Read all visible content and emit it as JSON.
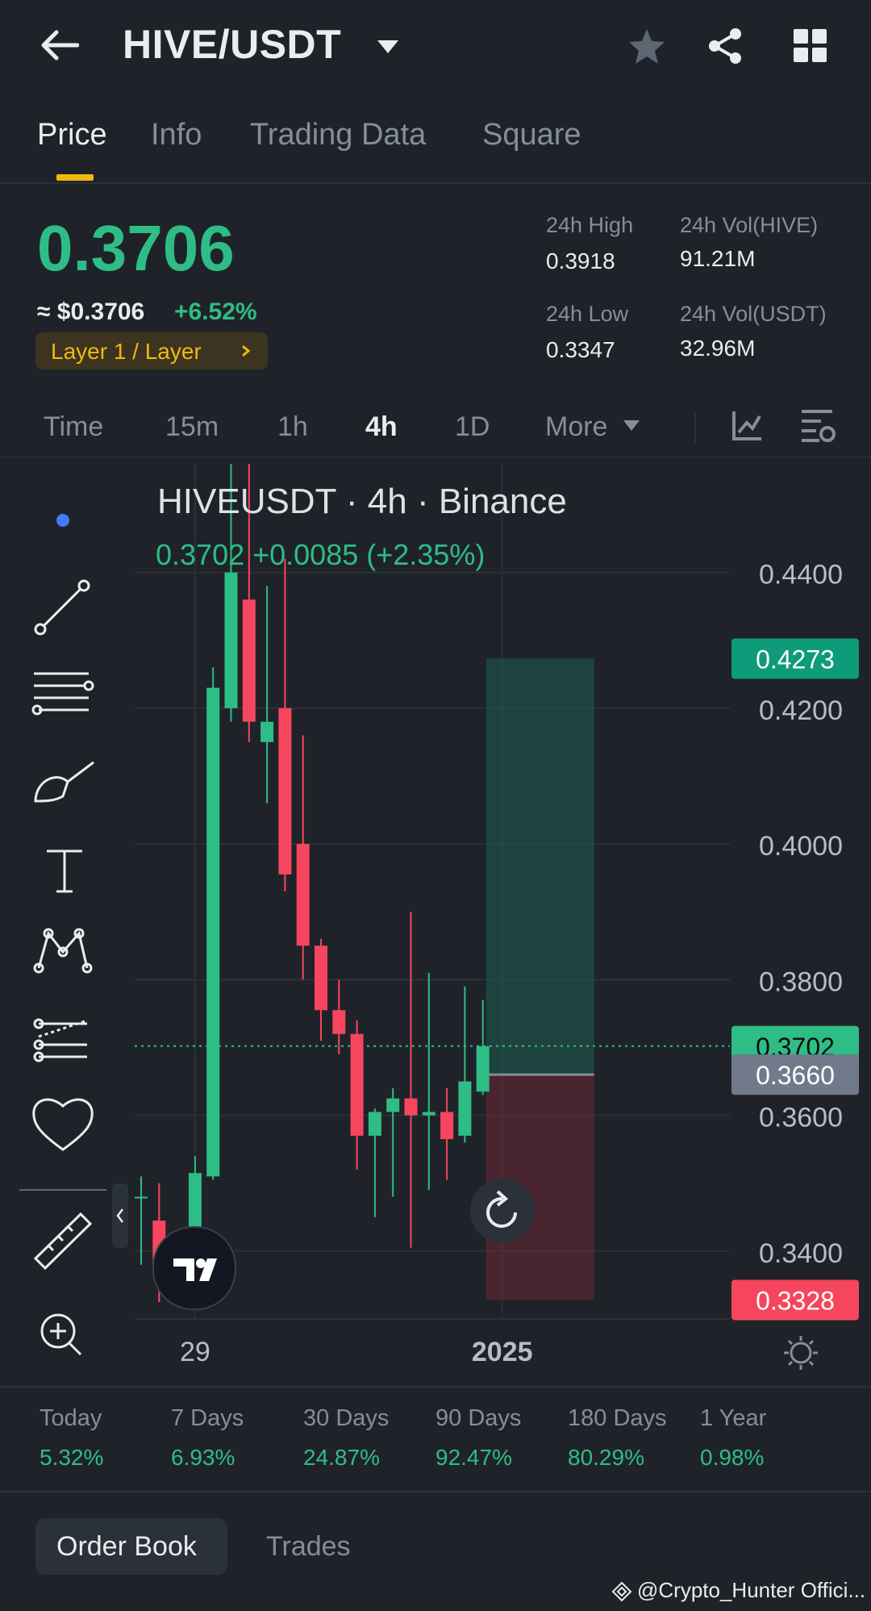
{
  "header": {
    "pair": "HIVE/USDT"
  },
  "tabs": [
    "Price",
    "Info",
    "Trading Data",
    "Square"
  ],
  "ticker": {
    "price": "0.3706",
    "approx": "≈ $0.3706",
    "change": "+6.52%",
    "tag": "Layer 1 / Layer",
    "high_label": "24h High",
    "high": "0.3918",
    "low_label": "24h Low",
    "low": "0.3347",
    "vol_base_label": "24h Vol(HIVE)",
    "vol_base": "91.21M",
    "vol_quote_label": "24h Vol(USDT)",
    "vol_quote": "32.96M"
  },
  "intervals": [
    "Time",
    "15m",
    "1h",
    "4h",
    "1D",
    "More"
  ],
  "active_interval": "4h",
  "chart_data": {
    "type": "candlestick",
    "title": "HIVEUSDT · 4h · Binance",
    "last_readout": "0.3702  +0.0085 (+2.35%)",
    "y_ticks": [
      "0.4400",
      "0.4200",
      "0.4000",
      "0.3800",
      "0.3600",
      "0.3400"
    ],
    "ylim": [
      0.33,
      0.456
    ],
    "x_labels": [
      "29",
      "2025"
    ],
    "price_tags": [
      {
        "value": "0.4273",
        "color": "#0d9b79"
      },
      {
        "value": "0.3702",
        "color": "#2ebd85"
      },
      {
        "value": "0.3660",
        "color": "#707a8a"
      },
      {
        "value": "0.3328",
        "color": "#f6465d"
      }
    ],
    "position": {
      "take_profit": 0.4273,
      "entry": 0.366,
      "stop_loss": 0.3328,
      "current": 0.3702
    },
    "candles": [
      {
        "o": 0.348,
        "h": 0.351,
        "l": 0.338,
        "c": 0.348
      },
      {
        "o": 0.3445,
        "h": 0.35,
        "l": 0.3325,
        "c": 0.338
      },
      {
        "o": 0.3395,
        "h": 0.342,
        "l": 0.333,
        "c": 0.3395
      },
      {
        "o": 0.335,
        "h": 0.354,
        "l": 0.333,
        "c": 0.3515
      },
      {
        "o": 0.351,
        "h": 0.426,
        "l": 0.3505,
        "c": 0.423
      },
      {
        "o": 0.42,
        "h": 0.46,
        "l": 0.418,
        "c": 0.44
      },
      {
        "o": 0.436,
        "h": 0.465,
        "l": 0.415,
        "c": 0.418
      },
      {
        "o": 0.415,
        "h": 0.438,
        "l": 0.406,
        "c": 0.418
      },
      {
        "o": 0.42,
        "h": 0.442,
        "l": 0.393,
        "c": 0.3955
      },
      {
        "o": 0.4,
        "h": 0.416,
        "l": 0.38,
        "c": 0.385
      },
      {
        "o": 0.385,
        "h": 0.386,
        "l": 0.371,
        "c": 0.3755
      },
      {
        "o": 0.3755,
        "h": 0.38,
        "l": 0.369,
        "c": 0.372
      },
      {
        "o": 0.372,
        "h": 0.374,
        "l": 0.352,
        "c": 0.357
      },
      {
        "o": 0.357,
        "h": 0.361,
        "l": 0.345,
        "c": 0.3605
      },
      {
        "o": 0.3605,
        "h": 0.364,
        "l": 0.348,
        "c": 0.3625
      },
      {
        "o": 0.3625,
        "h": 0.39,
        "l": 0.3405,
        "c": 0.36
      },
      {
        "o": 0.36,
        "h": 0.381,
        "l": 0.349,
        "c": 0.3605
      },
      {
        "o": 0.3605,
        "h": 0.364,
        "l": 0.3505,
        "c": 0.3565
      },
      {
        "o": 0.357,
        "h": 0.379,
        "l": 0.356,
        "c": 0.365
      },
      {
        "o": 0.3635,
        "h": 0.377,
        "l": 0.363,
        "c": 0.3702
      }
    ]
  },
  "performance": [
    {
      "label": "Today",
      "value": "5.32%"
    },
    {
      "label": "7 Days",
      "value": "6.93%"
    },
    {
      "label": "30 Days",
      "value": "24.87%"
    },
    {
      "label": "90 Days",
      "value": "92.47%"
    },
    {
      "label": "180 Days",
      "value": "80.29%"
    },
    {
      "label": "1 Year",
      "value": "0.98%"
    }
  ],
  "bottom_tabs": {
    "order_book": "Order Book",
    "trades": "Trades"
  },
  "watermark": "@Crypto_Hunter Offici..."
}
